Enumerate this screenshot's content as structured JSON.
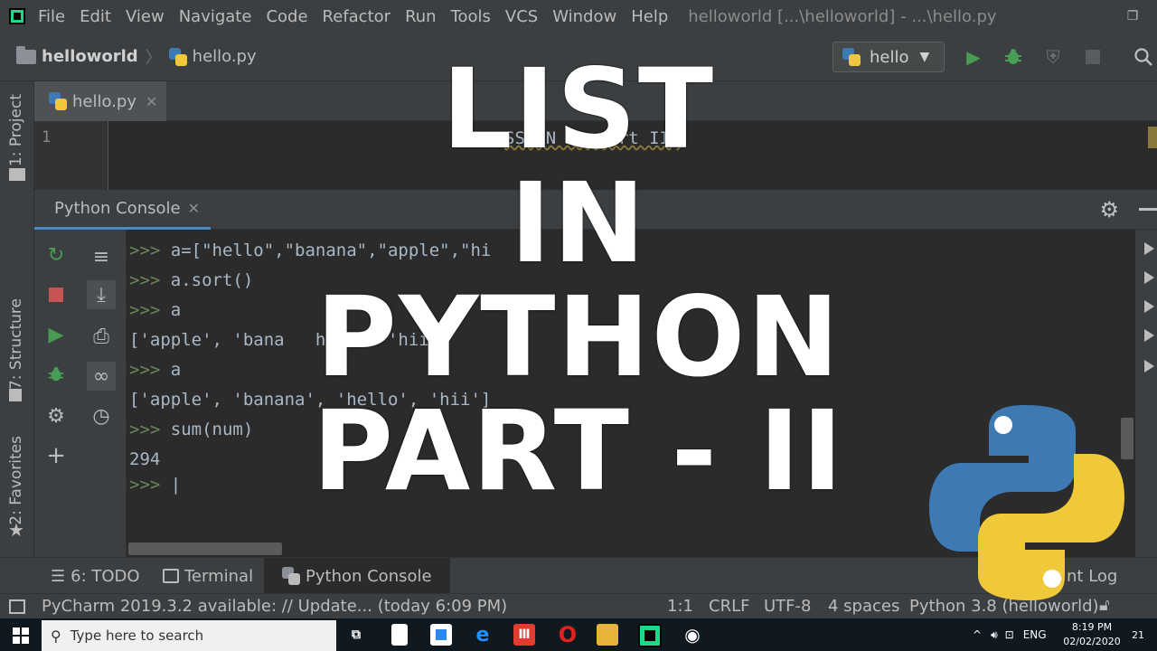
{
  "menubar": {
    "items": [
      "File",
      "Edit",
      "View",
      "Navigate",
      "Code",
      "Refactor",
      "Run",
      "Tools",
      "VCS",
      "Window",
      "Help"
    ],
    "title": "helloworld [...\\helloworld] - ...\\hello.py"
  },
  "navbar": {
    "project": "helloworld",
    "file": "hello.py",
    "run_config": "hello"
  },
  "left_strip": {
    "project_tab": "1: Project",
    "structure_tab": "7: Structure",
    "favorites_tab": "2: Favorites"
  },
  "editor": {
    "tab_label": "hello.py",
    "line_number": "1",
    "line_text": "SS IN  T   -   art II)"
  },
  "console": {
    "tab_label": "Python Console",
    "lines": [
      {
        "prompt": ">>>",
        "text": " a=[\"hello\",\"banana\",\"apple\",\"hi"
      },
      {
        "prompt": ">>>",
        "text": " a.sort()"
      },
      {
        "prompt": ">>>",
        "text": " a"
      },
      {
        "prompt": "",
        "text": "['apple', 'bana   hello  'hii'"
      },
      {
        "prompt": ">>>",
        "text": " a"
      },
      {
        "prompt": "",
        "text": "['apple', 'banana', 'hello', 'hii']"
      },
      {
        "prompt": ">>>",
        "text": " sum(num)"
      },
      {
        "prompt": "",
        "text": "294"
      },
      {
        "prompt": ">>>",
        "text": " |"
      }
    ]
  },
  "bottom_tabs": {
    "todo": "6: TODO",
    "terminal": "Terminal",
    "python_console": "Python Console",
    "event_log": "nt Log"
  },
  "statusbar": {
    "message": "PyCharm 2019.3.2 available: // Update... (today 6:09 PM)",
    "position": "1:1",
    "line_sep": "CRLF",
    "encoding": "UTF-8",
    "indent": "4 spaces",
    "interpreter": "Python 3.8 (helloworld)"
  },
  "taskbar": {
    "search_placeholder": "Type here to search",
    "lang": "ENG",
    "time": "8:19 PM",
    "date": "02/02/2020",
    "notifications": "21"
  },
  "overlay": {
    "line1": "LIST",
    "line2": "IN",
    "line3": "PYTHON",
    "line4": "PART - II"
  },
  "colors": {
    "accent": "#4a88c7",
    "run_green": "#499c54",
    "stop_red": "#c75450",
    "python_blue": "#3d7ab3",
    "python_yellow": "#f0c93a"
  }
}
